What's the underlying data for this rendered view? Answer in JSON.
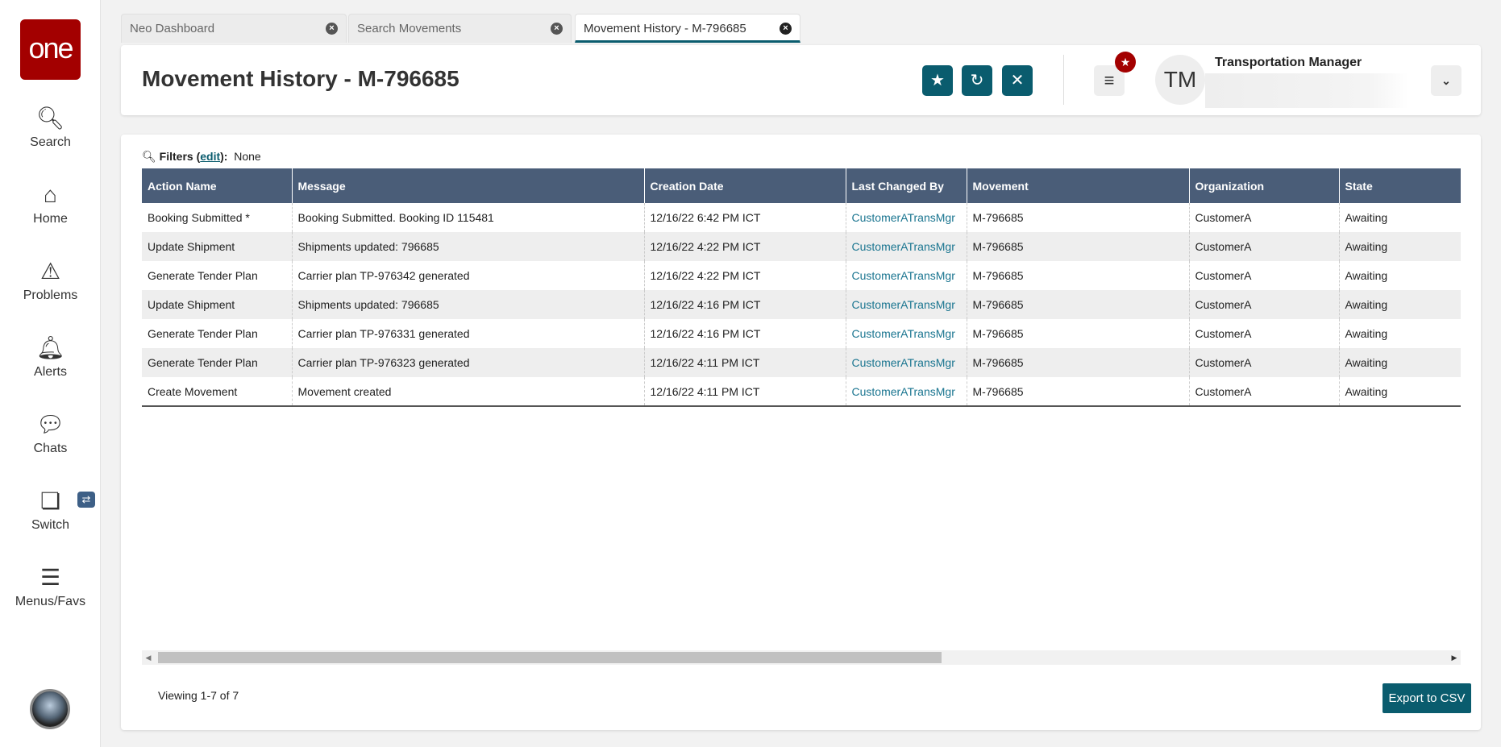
{
  "sidebar": {
    "logo": "one",
    "items": [
      {
        "label": "Search",
        "icon": "search-icon"
      },
      {
        "label": "Home",
        "icon": "home-icon"
      },
      {
        "label": "Problems",
        "icon": "warning-icon"
      },
      {
        "label": "Alerts",
        "icon": "bell-icon"
      },
      {
        "label": "Chats",
        "icon": "chat-icon"
      },
      {
        "label": "Switch",
        "icon": "switch-icon"
      },
      {
        "label": "Menus/Favs",
        "icon": "menu-icon"
      }
    ]
  },
  "tabs": [
    {
      "label": "Neo Dashboard"
    },
    {
      "label": "Search Movements"
    },
    {
      "label": "Movement History - M-796685",
      "active": true
    }
  ],
  "header": {
    "title": "Movement History - M-796685",
    "user_initials": "TM",
    "user_role": "Transportation Manager"
  },
  "filters": {
    "label": "Filters",
    "edit": "edit",
    "value": "None"
  },
  "table": {
    "columns": [
      "Action Name",
      "Message",
      "Creation Date",
      "Last Changed By",
      "Movement",
      "Organization",
      "State"
    ],
    "rows": [
      [
        "Booking Submitted *",
        "Booking Submitted. Booking ID 115481",
        "12/16/22 6:42 PM ICT",
        "CustomerATransMgr",
        "M-796685",
        "CustomerA",
        "Awaiting"
      ],
      [
        "Update Shipment",
        "Shipments updated: 796685",
        "12/16/22 4:22 PM ICT",
        "CustomerATransMgr",
        "M-796685",
        "CustomerA",
        "Awaiting"
      ],
      [
        "Generate Tender Plan",
        "Carrier plan TP-976342 generated",
        "12/16/22 4:22 PM ICT",
        "CustomerATransMgr",
        "M-796685",
        "CustomerA",
        "Awaiting"
      ],
      [
        "Update Shipment",
        "Shipments updated: 796685",
        "12/16/22 4:16 PM ICT",
        "CustomerATransMgr",
        "M-796685",
        "CustomerA",
        "Awaiting"
      ],
      [
        "Generate Tender Plan",
        "Carrier plan TP-976331 generated",
        "12/16/22 4:16 PM ICT",
        "CustomerATransMgr",
        "M-796685",
        "CustomerA",
        "Awaiting"
      ],
      [
        "Generate Tender Plan",
        "Carrier plan TP-976323 generated",
        "12/16/22 4:11 PM ICT",
        "CustomerATransMgr",
        "M-796685",
        "CustomerA",
        "Awaiting"
      ],
      [
        "Create Movement",
        "Movement created",
        "12/16/22 4:11 PM ICT",
        "CustomerATransMgr",
        "M-796685",
        "CustomerA",
        "Awaiting"
      ]
    ]
  },
  "footer": {
    "viewing": "Viewing 1-7 of 7",
    "export": "Export to CSV"
  },
  "colors": {
    "accent": "#0a5c6e",
    "header": "#4a5d78",
    "brand": "#a30000"
  }
}
